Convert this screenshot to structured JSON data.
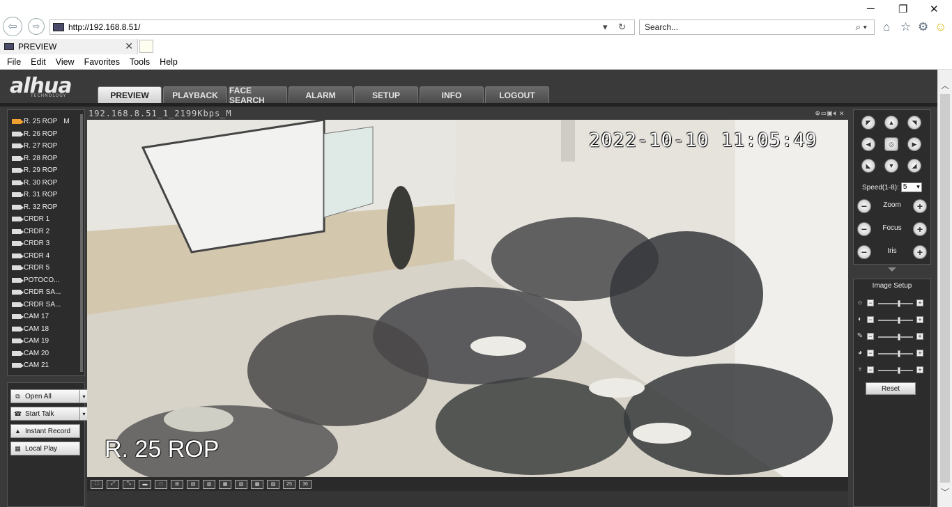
{
  "browser": {
    "url": "http://192.168.8.51/",
    "search_placeholder": "Search...",
    "tab_title": "PREVIEW",
    "menu": [
      "File",
      "Edit",
      "View",
      "Favorites",
      "Tools",
      "Help"
    ]
  },
  "app": {
    "logo": "alhua",
    "logo_sub": "TECHNOLOGY",
    "nav": [
      "PREVIEW",
      "PLAYBACK",
      "FACE SEARCH",
      "ALARM",
      "SETUP",
      "INFO",
      "LOGOUT"
    ],
    "active_nav": "PREVIEW",
    "channels": [
      {
        "label": "R. 25 ROP",
        "badge": "M",
        "active": true
      },
      {
        "label": "R. 26 ROP"
      },
      {
        "label": "R. 27 ROP"
      },
      {
        "label": "R. 28 ROP"
      },
      {
        "label": "R. 29 ROP"
      },
      {
        "label": "R. 30 ROP"
      },
      {
        "label": "R. 31 ROP"
      },
      {
        "label": "R. 32 ROP"
      },
      {
        "label": "CRDR 1"
      },
      {
        "label": "CRDR 2"
      },
      {
        "label": "CRDR 3"
      },
      {
        "label": "CRDR 4"
      },
      {
        "label": "CRDR 5"
      },
      {
        "label": "POTOCO..."
      },
      {
        "label": "CRDR SA..."
      },
      {
        "label": "CRDR SA..."
      },
      {
        "label": "CAM 17"
      },
      {
        "label": "CAM 18"
      },
      {
        "label": "CAM 19"
      },
      {
        "label": "CAM 20"
      },
      {
        "label": "CAM 21"
      }
    ],
    "actions": {
      "open_all": "Open All",
      "start_talk": "Start Talk",
      "instant_record": "Instant Record",
      "local_play": "Local Play"
    },
    "video": {
      "stream_label": "192.168.8.51_1_2199Kbps_M",
      "timestamp": "2022-10-10 11:05:49",
      "camera_name": "R. 25 ROP",
      "split_labels": [
        "",
        "",
        "",
        "",
        "",
        "",
        "",
        "",
        "",
        "",
        "",
        "",
        "25",
        "36"
      ]
    },
    "ptz": {
      "speed_label": "Speed(1-8):",
      "speed_value": "5",
      "zoom": "Zoom",
      "focus": "Focus",
      "iris": "Iris"
    },
    "image_setup": {
      "title": "Image Setup",
      "reset": "Reset",
      "sliders": [
        {
          "icon": "brightness-icon",
          "level": 0.6
        },
        {
          "icon": "contrast-icon",
          "level": 0.6
        },
        {
          "icon": "saturation-icon",
          "level": 0.6
        },
        {
          "icon": "hue-icon",
          "level": 0.6
        },
        {
          "icon": "sharpness-icon",
          "level": 0.6
        }
      ]
    }
  }
}
